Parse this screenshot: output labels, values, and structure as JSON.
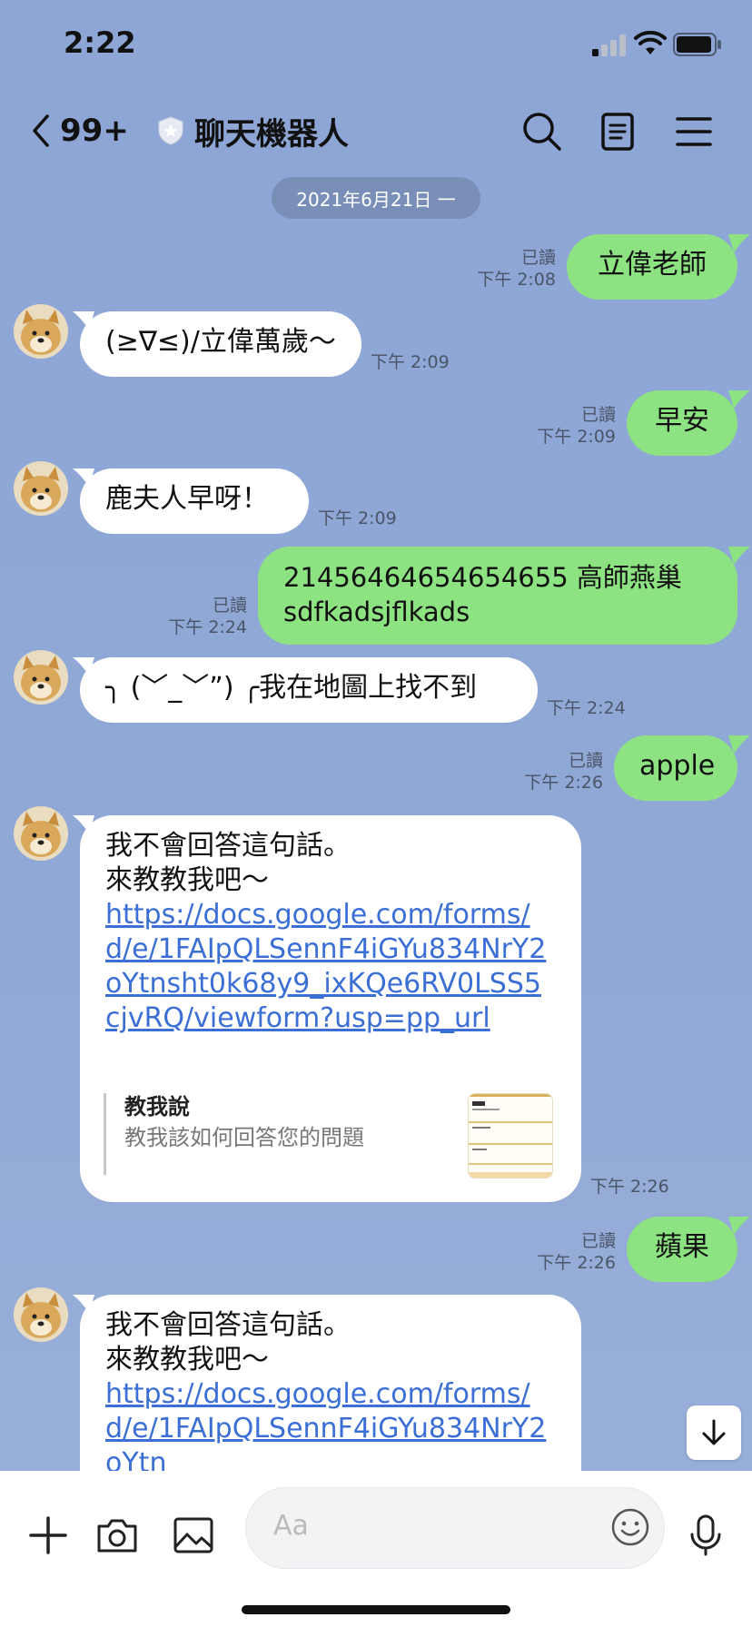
{
  "status_bar": {
    "time": "2:22"
  },
  "header": {
    "back_count": "99+",
    "title": "聊天機器人"
  },
  "date_pill": "2021年6月21日 一",
  "messages": [
    {
      "dir": "out",
      "text": "立偉老師",
      "read": "已讀",
      "time": "下午 2:08"
    },
    {
      "dir": "in",
      "text": "(≥∇≤)/立偉萬歲～",
      "time": "下午 2:09"
    },
    {
      "dir": "out",
      "text": "早安",
      "read": "已讀",
      "time": "下午 2:09"
    },
    {
      "dir": "in",
      "text": "鹿夫人早呀！",
      "time": "下午 2:09"
    },
    {
      "dir": "out",
      "text_line1": "21456464654654655 高師燕巢",
      "text_line2": "sdfkadsjflkads",
      "read": "已讀",
      "time": "下午 2:24"
    },
    {
      "dir": "in",
      "text": "╮ (﹀_﹀”) ╭我在地圖上找不到",
      "time": "下午 2:24"
    },
    {
      "dir": "out",
      "text": "apple",
      "read": "已讀",
      "time": "下午 2:26"
    },
    {
      "dir": "in",
      "line1": "我不會回答這句話。",
      "line2": "來教教我吧～",
      "link": "https://docs.google.com/forms/d/e/1FAIpQLSennF4iGYu834NrY2oYtnsht0k68y9_ixKQe6RV0LSS5cjvRQ/viewform?usp=pp_url",
      "preview_title": "教我說",
      "preview_desc": "教我該如何回答您的問題",
      "time": "下午 2:26"
    },
    {
      "dir": "out",
      "text": "蘋果",
      "read": "已讀",
      "time": "下午 2:26"
    },
    {
      "dir": "in",
      "line1": "我不會回答這句話。",
      "line2": "來教教我吧～",
      "link": "https://docs.google.com/forms/d/e/1FAIpQLSennF4iGYu834NrY2oYtn"
    }
  ],
  "input": {
    "placeholder": "Aa"
  },
  "colors": {
    "background": "#8fa7d4",
    "outgoing": "#8de382",
    "incoming": "#ffffff",
    "link": "#3b6fd6"
  }
}
